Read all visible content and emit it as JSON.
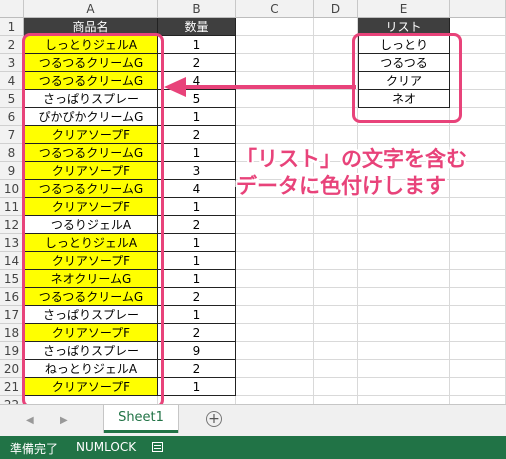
{
  "columns": [
    "A",
    "B",
    "C",
    "D",
    "E"
  ],
  "rows": [
    "1",
    "2",
    "3",
    "4",
    "5",
    "6",
    "7",
    "8",
    "9",
    "10",
    "11",
    "12",
    "13",
    "14",
    "15",
    "16",
    "17",
    "18",
    "19",
    "20",
    "21",
    "22"
  ],
  "headers": {
    "product": "商品名",
    "quantity": "数量",
    "list": "リスト"
  },
  "products": [
    {
      "name": "しっとりジェルA",
      "qty": "1",
      "highlight": true
    },
    {
      "name": "つるつるクリームG",
      "qty": "2",
      "highlight": true
    },
    {
      "name": "つるつるクリームG",
      "qty": "4",
      "highlight": true
    },
    {
      "name": "さっぱりスプレー",
      "qty": "5",
      "highlight": false
    },
    {
      "name": "ぴかぴかクリームG",
      "qty": "1",
      "highlight": false
    },
    {
      "name": "クリアソープF",
      "qty": "2",
      "highlight": true
    },
    {
      "name": "つるつるクリームG",
      "qty": "1",
      "highlight": true
    },
    {
      "name": "クリアソープF",
      "qty": "3",
      "highlight": true
    },
    {
      "name": "つるつるクリームG",
      "qty": "4",
      "highlight": true
    },
    {
      "name": "クリアソープF",
      "qty": "1",
      "highlight": true
    },
    {
      "name": "つるりジェルA",
      "qty": "2",
      "highlight": false
    },
    {
      "name": "しっとりジェルA",
      "qty": "1",
      "highlight": true
    },
    {
      "name": "クリアソープF",
      "qty": "1",
      "highlight": true
    },
    {
      "name": "ネオクリームG",
      "qty": "1",
      "highlight": true
    },
    {
      "name": "つるつるクリームG",
      "qty": "2",
      "highlight": true
    },
    {
      "name": "さっぱりスプレー",
      "qty": "1",
      "highlight": false
    },
    {
      "name": "クリアソープF",
      "qty": "2",
      "highlight": true
    },
    {
      "name": "さっぱりスプレー",
      "qty": "9",
      "highlight": false
    },
    {
      "name": "ねっとりジェルA",
      "qty": "2",
      "highlight": false
    },
    {
      "name": "クリアソープF",
      "qty": "1",
      "highlight": true
    }
  ],
  "list_items": [
    "しっとり",
    "つるつる",
    "クリア",
    "ネオ"
  ],
  "annotation": {
    "line1": "「リスト」の文字を含む",
    "line2": "データに色付けします"
  },
  "tabs": {
    "sheet_name": "Sheet1",
    "add_symbol": "+",
    "prev": "◀",
    "next": "▶"
  },
  "status": {
    "ready": "準備完了",
    "numlock": "NUMLOCK"
  },
  "colors": {
    "highlight": "#ffff00",
    "accent": "#e8437a",
    "header_bg": "#3f3f3f",
    "status_bg": "#217346"
  }
}
